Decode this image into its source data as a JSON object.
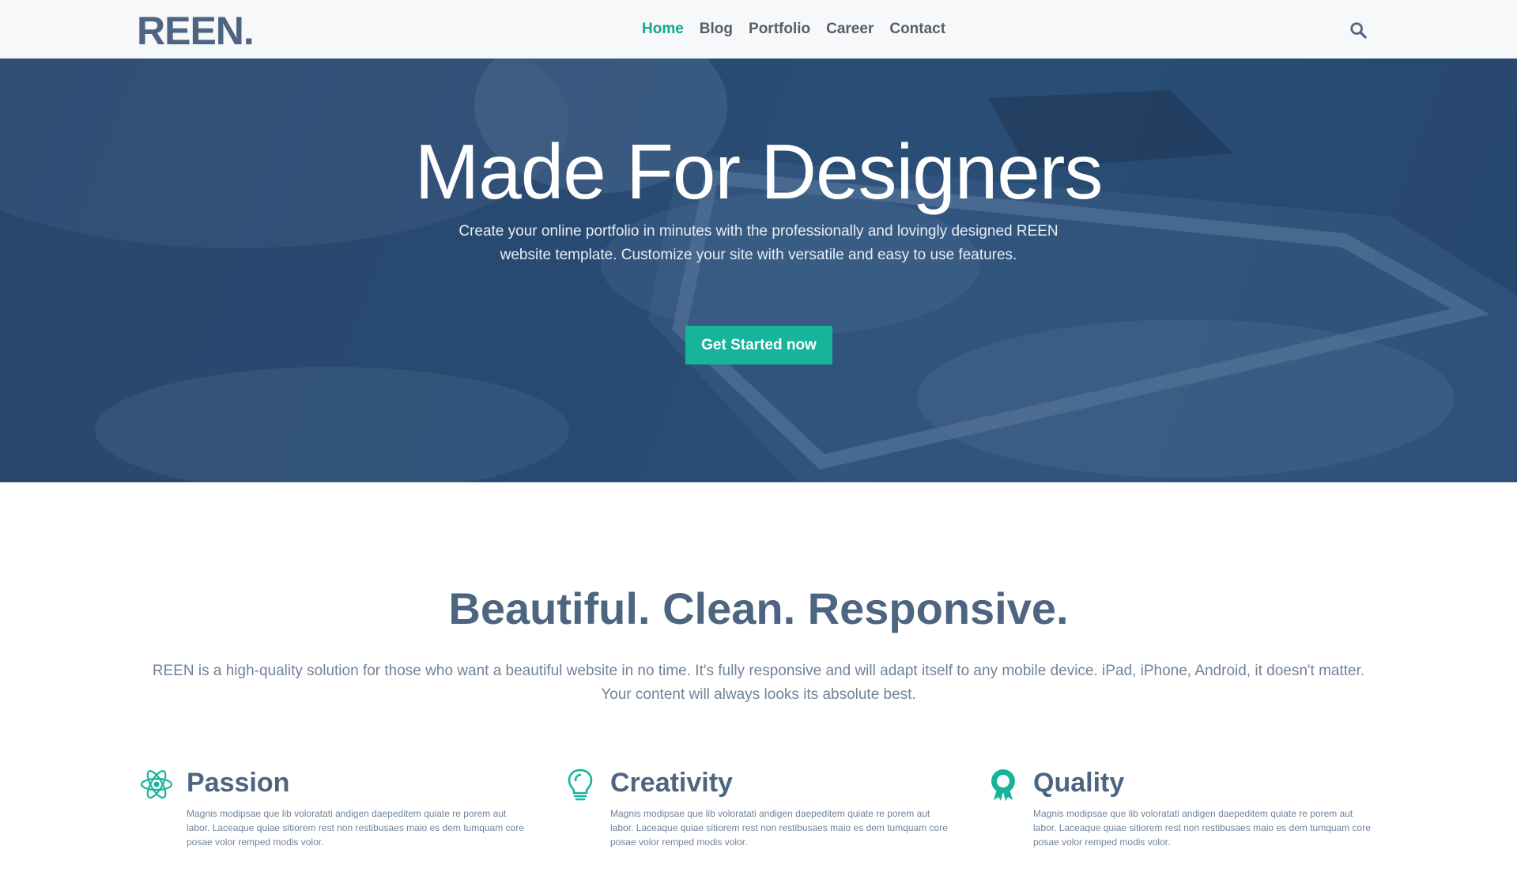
{
  "brand": {
    "logo": "REEN."
  },
  "nav": {
    "items": [
      {
        "label": "Home",
        "active": true
      },
      {
        "label": "Blog",
        "active": false
      },
      {
        "label": "Portfolio",
        "active": false
      },
      {
        "label": "Career",
        "active": false
      },
      {
        "label": "Contact",
        "active": false
      }
    ],
    "search_icon": "search-icon"
  },
  "hero": {
    "title": "Made For Designers",
    "subtitle_line1": "Create your online portfolio in minutes with the professionally and lovingly designed REEN",
    "subtitle_line2": "website template. Customize your site with versatile and easy to use features.",
    "cta_label": "Get Started now"
  },
  "intro": {
    "title": "Beautiful. Clean. Responsive.",
    "text": "REEN is a high-quality solution for those who want a beautiful website in no time. It's fully responsive and will adapt itself to any mobile device. iPad, iPhone, Android, it doesn't matter. Your content will always looks its absolute best."
  },
  "features": [
    {
      "title": "Passion",
      "icon": "atom-icon",
      "text": "Magnis modipsae que lib voloratati andigen daepeditem quiate re porem aut labor. Laceaque quiae sitiorem rest non restibusaes maio es dem tumquam core posae volor remped modis volor."
    },
    {
      "title": "Creativity",
      "icon": "lightbulb-icon",
      "text": "Magnis modipsae que lib voloratati andigen daepeditem quiate re porem aut labor. Laceaque quiae sitiorem rest non restibusaes maio es dem tumquam core posae volor remped modis volor."
    },
    {
      "title": "Quality",
      "icon": "award-icon",
      "text": "Magnis modipsae que lib voloratati andigen daepeditem quiate re porem aut labor. Laceaque quiae sitiorem rest non restibusaes maio es dem tumquam core posae volor remped modis volor."
    }
  ],
  "colors": {
    "accent": "#16b49b",
    "nav_active": "#16a68f",
    "heading": "#4d6580",
    "hero_bg": "#2b5079"
  }
}
